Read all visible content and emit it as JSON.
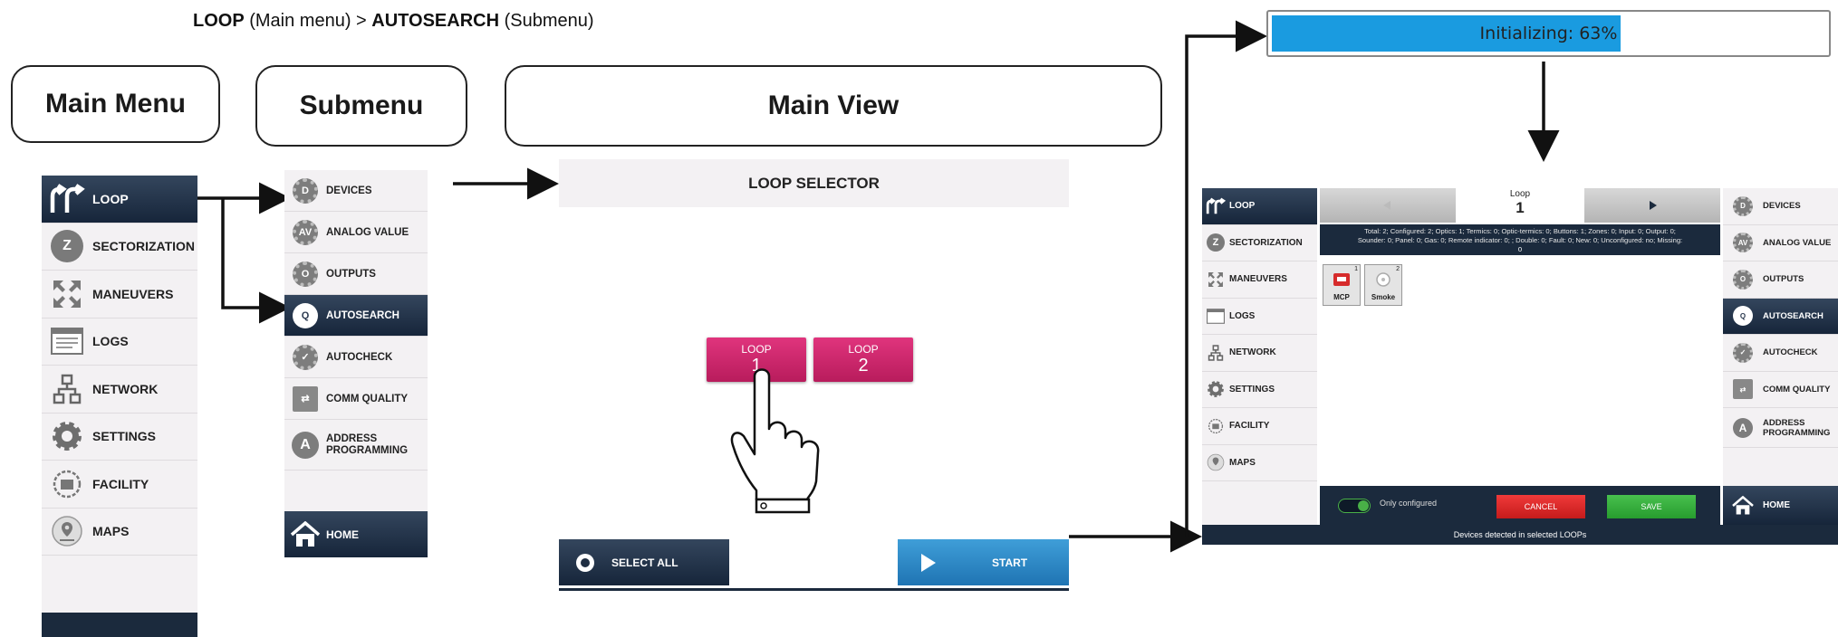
{
  "breadcrumb": {
    "part1": "LOOP",
    "part2": " (Main menu) > ",
    "part3": "AUTOSEARCH",
    "part4": " (Submenu)"
  },
  "labels": {
    "main_menu": "Main Menu",
    "submenu": "Submenu",
    "main_view": "Main View"
  },
  "main_menu": {
    "items": [
      {
        "label": "LOOP",
        "icon": "loop-arrows-icon",
        "active": true
      },
      {
        "label": "SECTORIZATION",
        "icon": "z-circle-icon",
        "letter": "Z"
      },
      {
        "label": "MANEUVERS",
        "icon": "maneuvers-arrows-icon"
      },
      {
        "label": "LOGS",
        "icon": "logs-window-icon"
      },
      {
        "label": "NETWORK",
        "icon": "network-icon"
      },
      {
        "label": "SETTINGS",
        "icon": "settings-gear-icon"
      },
      {
        "label": "FACILITY",
        "icon": "facility-icon"
      },
      {
        "label": "MAPS",
        "icon": "map-pin-icon"
      }
    ]
  },
  "submenu": {
    "items": [
      {
        "label": "DEVICES",
        "badge": "D"
      },
      {
        "label": "ANALOG VALUE",
        "badge": "AV"
      },
      {
        "label": "OUTPUTS",
        "badge": "O"
      },
      {
        "label": "AUTOSEARCH",
        "badge": "Q",
        "active": true
      },
      {
        "label": "AUTOCHECK",
        "badge": "✓"
      },
      {
        "label": "COMM QUALITY",
        "badge": "⇄"
      },
      {
        "label": "ADDRESS PROGRAMMING",
        "badge": "A"
      }
    ],
    "home": "HOME"
  },
  "main_view": {
    "title": "LOOP SELECTOR",
    "loops": [
      {
        "top": "LOOP",
        "num": "1"
      },
      {
        "top": "LOOP",
        "num": "2"
      }
    ],
    "select_all": "SELECT ALL",
    "start": "START"
  },
  "progress": {
    "text": "Initializing: 63%",
    "value": 0.63,
    "color": "#1a9be0"
  },
  "result": {
    "nav_label": "Loop",
    "nav_value": "1",
    "stats_line1": "Total: 2; Configured: 2; Optics: 1; Termics: 0; Optic-termics: 0; Buttons: 1; Zones: 0; Input: 0; Output: 0;",
    "stats_line2": "Sounder: 0; Panel: 0; Gas: 0; Remote indicator: 0; ; Double: 0; Fault: 0; New: 0; Unconfigured: no; Missing:",
    "stats_line3": "0",
    "devices": [
      {
        "num": "1",
        "label": "MCP"
      },
      {
        "num": "2",
        "label": "Smoke"
      }
    ],
    "only_configured": "Only configured",
    "cancel": "CANCEL",
    "save": "SAVE",
    "home": "HOME",
    "footer": "Devices detected in selected LOOPs",
    "menu": [
      "LOOP",
      "SECTORIZATION",
      "MANEUVERS",
      "LOGS",
      "NETWORK",
      "SETTINGS",
      "FACILITY",
      "MAPS"
    ],
    "submenu": [
      "DEVICES",
      "ANALOG VALUE",
      "OUTPUTS",
      "AUTOSEARCH",
      "AUTOCHECK",
      "COMM QUALITY",
      "ADDRESS PROGRAMMING"
    ]
  }
}
